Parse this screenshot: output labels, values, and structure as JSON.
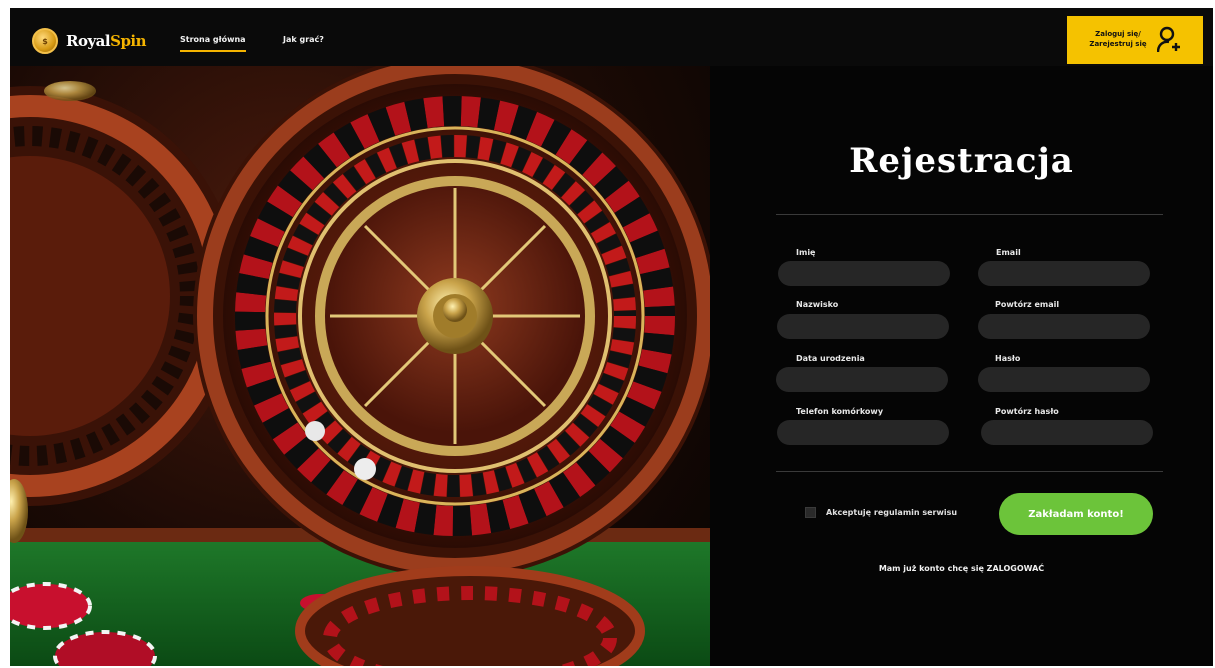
{
  "nav": {
    "brand_primary": "Royal",
    "brand_accent": "Spin",
    "links": [
      {
        "label": "Strona główna",
        "active": true
      },
      {
        "label": "Jak grać?",
        "active": false
      }
    ],
    "login_line1": "Zaloguj się/",
    "login_line2": "Zarejestruj się",
    "login_icon": "user-add-icon"
  },
  "form": {
    "title": "Rejestracja",
    "fields": [
      {
        "label": "Imię",
        "value": "",
        "placeholder": ""
      },
      {
        "label": "Email",
        "value": "",
        "placeholder": ""
      },
      {
        "label": "Nazwisko",
        "value": "",
        "placeholder": ""
      },
      {
        "label": "Powtórz email",
        "value": "",
        "placeholder": ""
      },
      {
        "label": "Data urodzenia",
        "value": "",
        "placeholder": ""
      },
      {
        "label": "Hasło",
        "value": "",
        "placeholder": ""
      },
      {
        "label": "Telefon komórkowy",
        "value": "",
        "placeholder": ""
      },
      {
        "label": "Powtórz hasło",
        "value": "",
        "placeholder": ""
      }
    ],
    "terms_label": "Akceptuję regulamin serwisu",
    "terms_checked": false,
    "submit_label": "Zakładam konto!",
    "footer_text": "Mam już konto chcę się ZALOGOWAĆ"
  },
  "colors": {
    "accent_yellow": "#f5c200",
    "submit_green": "#6cc43a",
    "background": "#050505",
    "input_bg": "#262626"
  }
}
